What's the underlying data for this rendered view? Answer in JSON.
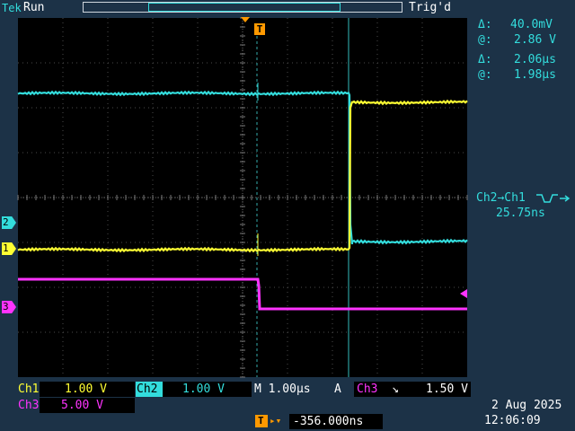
{
  "header": {
    "brand": "Tek",
    "run_state": "Run",
    "trigger_state": "Trig'd",
    "trigger_marker": "T"
  },
  "cursors": {
    "delta_v_symbol": "Δ:",
    "delta_v": "40.0mV",
    "at_v_symbol": "@:",
    "at_v": "2.86 V",
    "delta_t_symbol": "Δ:",
    "delta_t": "2.06µs",
    "at_t_symbol": "@:",
    "at_t": "1.98µs"
  },
  "measurement": {
    "label": "Ch2→Ch1",
    "value": "25.75ns"
  },
  "channel_markers": {
    "ch1": "1",
    "ch2": "2",
    "ch3": "3"
  },
  "status": {
    "ch1_label": "Ch1",
    "ch1_scale": "1.00 V",
    "ch2_label": "Ch2",
    "ch2_scale": "1.00 V",
    "timebase": "M 1.00µs",
    "trigger_source_prefix": "A",
    "trigger_source": "Ch3",
    "trigger_slope": "↘",
    "trigger_level": "1.50 V",
    "ch3_label": "Ch3",
    "ch3_scale": "5.00 V",
    "horizontal_position": "-356.000ns",
    "date": "2 Aug 2025",
    "time": "12:06:09"
  },
  "colors": {
    "background": "#1c3247",
    "screen": "#000000",
    "ch1": "#ffff33",
    "ch2": "#33dddd",
    "ch3": "#ff33ff",
    "trigger": "#ff9900",
    "grid": "#4a4a4a"
  }
}
